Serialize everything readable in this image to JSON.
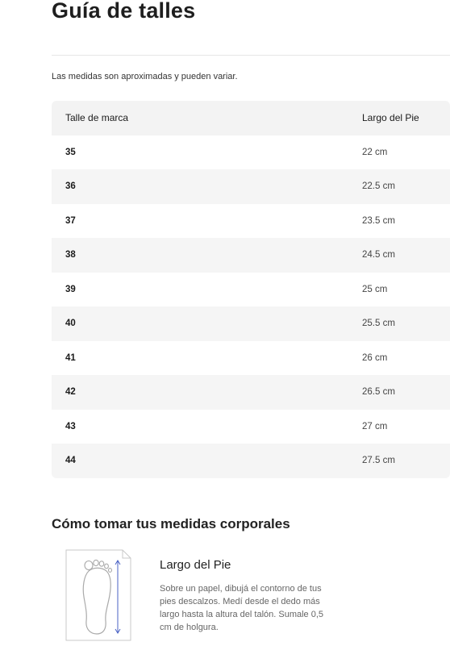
{
  "page": {
    "title": "Guía de talles",
    "note": "Las medidas son aproximadas y pueden variar."
  },
  "table": {
    "headers": [
      "Talle de marca",
      "Largo del Pie"
    ],
    "rows": [
      [
        "35",
        "22 cm"
      ],
      [
        "36",
        "22.5 cm"
      ],
      [
        "37",
        "23.5 cm"
      ],
      [
        "38",
        "24.5 cm"
      ],
      [
        "39",
        "25 cm"
      ],
      [
        "40",
        "25.5 cm"
      ],
      [
        "41",
        "26 cm"
      ],
      [
        "42",
        "26.5 cm"
      ],
      [
        "43",
        "27 cm"
      ],
      [
        "44",
        "27.5 cm"
      ]
    ]
  },
  "measures": {
    "section_title": "Cómo tomar tus medidas corporales",
    "item": {
      "icon": "foot-outline-icon",
      "title": "Largo del Pie",
      "description": "Sobre un papel, dibujá el contorno de tus pies descalzos. Medí desde el dedo más largo hasta la altura del talón. Sumale 0,5 cm de holgura."
    }
  },
  "colors": {
    "accent": "#4a62c4",
    "row_stripe": "#f5f5f5",
    "header_bg": "#f3f3f3"
  }
}
